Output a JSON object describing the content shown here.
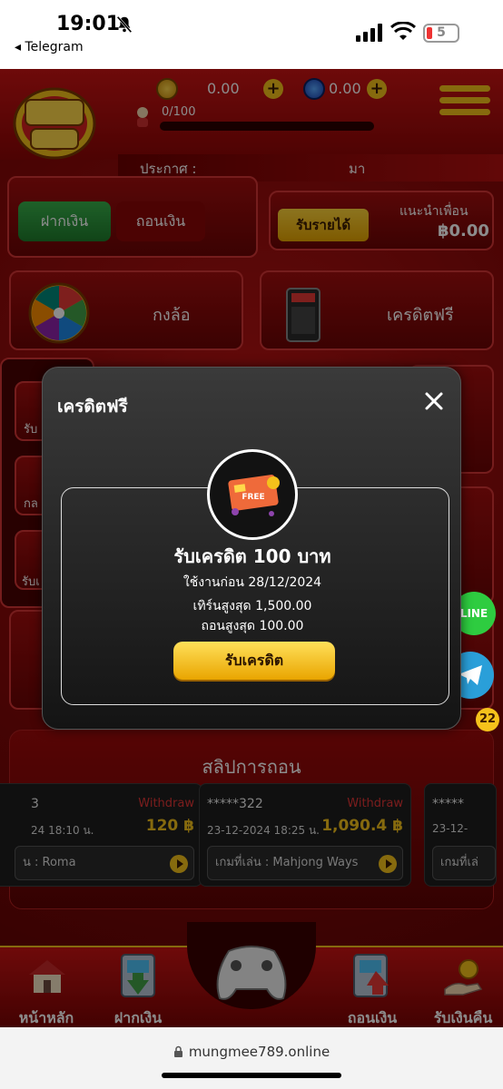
{
  "status_bar": {
    "time": "19:01",
    "back_app": "◂ Telegram",
    "battery": "5"
  },
  "header": {
    "logo_text": "มังมี 789",
    "coin_balance": "0.00",
    "gem_balance": "0.00",
    "level_progress": "0/100",
    "announcement_label": "ประกาศ :",
    "announcement_text": "มา"
  },
  "wallet": {
    "deposit_label": "ฝากเงิน",
    "withdraw_label": "ถอนเงิน"
  },
  "referral": {
    "earn_button": "รับรายได้",
    "label": "แนะนำเพื่อน",
    "amount": "฿0.00"
  },
  "features": {
    "wheel_label": "กงล้อ",
    "free_credit_label": "เครดิตฟรี"
  },
  "left_tiles": [
    "รับ",
    "กล",
    "รับเ"
  ],
  "modal": {
    "title": "เครดิตฟรี",
    "headline": "รับเครดิต 100 บาท",
    "use_before": "ใช้งานก่อน 28/12/2024",
    "max_turnover": "เทิร์นสูงสุด 1,500.00",
    "max_withdraw": "ถอนสูงสุด 100.00",
    "claim_button": "รับเครดิต",
    "card_badge_text": "FREE"
  },
  "withdraw_slips": {
    "title": "สลิปการถอน",
    "slips": [
      {
        "name": "3",
        "tag": "Withdraw",
        "date": "24 18:10 น.",
        "amount": "120 ฿",
        "game": "น : Roma"
      },
      {
        "name": "*****322",
        "tag": "Withdraw",
        "date": "23-12-2024 18:25 น.",
        "amount": "1,090.4 ฿",
        "game": "เกมที่เล่น : Mahjong Ways"
      },
      {
        "name": "*****",
        "tag": "",
        "date": "23-12-",
        "amount": "",
        "game": "เกมที่เล่"
      }
    ]
  },
  "floating": {
    "line_label": "LINE",
    "notif_count": "22"
  },
  "bottom_nav": [
    {
      "label": "หน้าหลัก"
    },
    {
      "label": "ฝากเงิน"
    },
    {
      "label": "ถอนเงิน"
    },
    {
      "label": "รับเงินคืน"
    }
  ],
  "browser": {
    "url": "mungmee789.online"
  },
  "colors": {
    "brand_red": "#b71414",
    "gold": "#f5c21b",
    "deposit_green": "#2e9a3e",
    "withdraw_tag": "#e03535"
  }
}
